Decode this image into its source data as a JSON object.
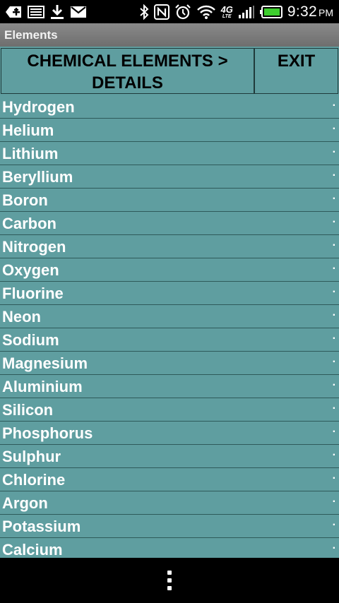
{
  "status_bar": {
    "icons_left": [
      "add-icon",
      "screenshot-icon",
      "download-icon",
      "gmail-icon"
    ],
    "icons_right": [
      "bluetooth-icon",
      "nfc-icon",
      "alarm-icon",
      "wifi-icon",
      "4g-lte-icon",
      "signal-icon",
      "battery-icon"
    ],
    "network_label": "4G",
    "lte_label": "LTE",
    "time": "9:32",
    "ampm": "PM"
  },
  "titlebar": {
    "title": "Elements"
  },
  "header": {
    "details_line1": "CHEMICAL ELEMENTS >",
    "details_line2": "DETAILS",
    "exit_label": "EXIT"
  },
  "elements": [
    "Hydrogen",
    "Helium",
    "Lithium",
    "Beryllium",
    "Boron",
    "Carbon",
    "Nitrogen",
    "Oxygen",
    "Fluorine",
    "Neon",
    "Sodium",
    "Magnesium",
    "Aluminium",
    "Silicon",
    "Phosphorus",
    "Sulphur",
    "Chlorine",
    "Argon",
    "Potassium",
    "Calcium"
  ],
  "row_marker": "·",
  "navbar": {
    "icon": "overflow-menu-icon"
  },
  "colors": {
    "list_bg": "#5f9ea0",
    "header_text": "#000000",
    "row_text": "#ffffff"
  }
}
